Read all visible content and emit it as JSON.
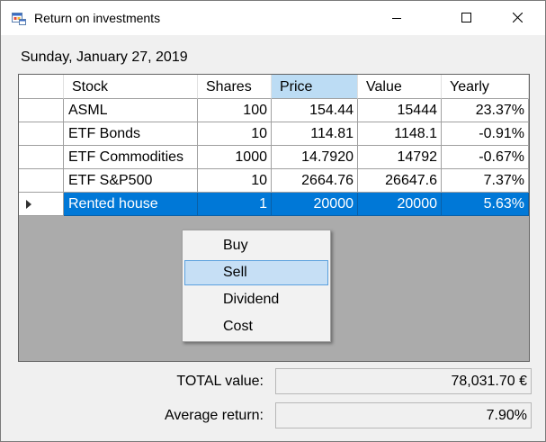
{
  "window": {
    "title": "Return on investments"
  },
  "date": "Sunday, January 27, 2019",
  "grid": {
    "columns": [
      "Stock",
      "Shares",
      "Price",
      "Value",
      "Yearly"
    ],
    "rows": [
      {
        "stock": "ASML",
        "shares": "100",
        "price": "154.44",
        "value": "15444",
        "yearly": "23.37%"
      },
      {
        "stock": "ETF Bonds",
        "shares": "10",
        "price": "114.81",
        "value": "1148.1",
        "yearly": "-0.91%"
      },
      {
        "stock": "ETF Commodities",
        "shares": "1000",
        "price": "14.7920",
        "value": "14792",
        "yearly": "-0.67%"
      },
      {
        "stock": "ETF S&P500",
        "shares": "10",
        "price": "2664.76",
        "value": "26647.6",
        "yearly": "7.37%"
      },
      {
        "stock": "Rented house",
        "shares": "1",
        "price": "20000",
        "value": "20000",
        "yearly": "5.63%"
      }
    ]
  },
  "context_menu": {
    "items": [
      "Buy",
      "Sell",
      "Dividend",
      "Cost"
    ]
  },
  "summary": {
    "total_label": "TOTAL value:",
    "total_value": "78,031.70 €",
    "avg_label": "Average return:",
    "avg_value": "7.90%"
  },
  "colors": {
    "selection": "#0078d7",
    "header_highlight": "#bcdcf4",
    "menu_hover": "#c6dff5",
    "grid_background": "#ababab"
  }
}
